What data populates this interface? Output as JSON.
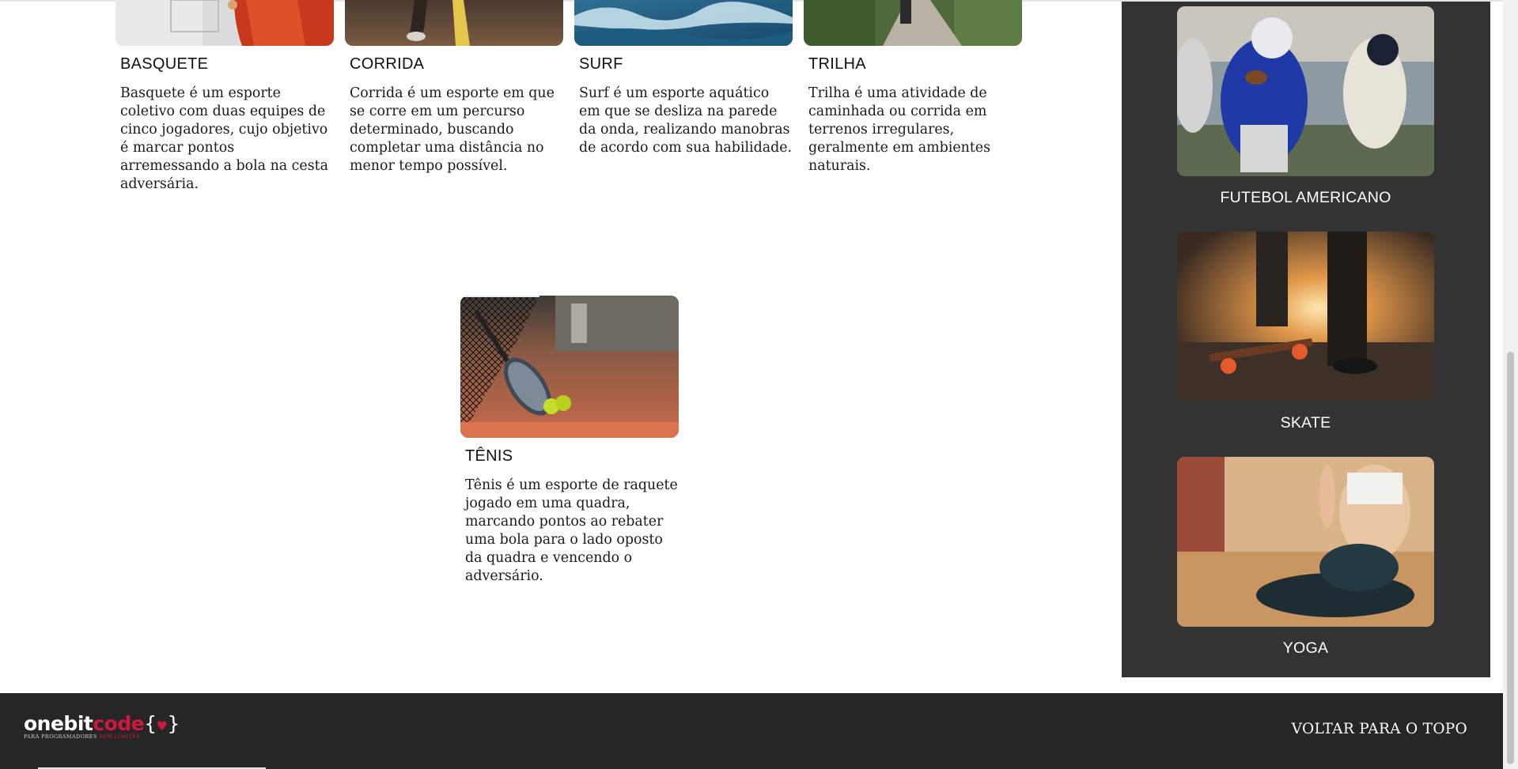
{
  "cards_top": [
    {
      "title": "BASQUETE",
      "text": "Basquete é um esporte coletivo com duas equipes de cinco jogadores, cujo objetivo é marcar pontos arremessando a bola na cesta adversária.",
      "image_alt": "basketball-photo"
    },
    {
      "title": "CORRIDA",
      "text": "Corrida é um esporte em que se corre em um percurso determinado, buscando completar uma distância no menor tempo possível.",
      "image_alt": "running-photo"
    },
    {
      "title": "SURF",
      "text": "Surf é um esporte aquático em que se desliza na parede da onda, realizando manobras de acordo com sua habilidade.",
      "image_alt": "surf-photo"
    },
    {
      "title": "TRILHA",
      "text": "Trilha é uma atividade de caminhada ou corrida em terrenos irregulares, geralmente em ambientes naturais.",
      "image_alt": "trail-photo"
    }
  ],
  "card_tenis": {
    "title": "TÊNIS",
    "text": "Tênis é um esporte de raquete jogado em uma quadra, marcando pontos ao rebater uma bola para o lado oposto da quadra e vencendo o adversário.",
    "image_alt": "tennis-photo"
  },
  "sidebar": {
    "items": [
      {
        "label": "FUTEBOL AMERICANO",
        "image_alt": "american-football-photo"
      },
      {
        "label": "SKATE",
        "image_alt": "skate-photo"
      },
      {
        "label": "YOGA",
        "image_alt": "yoga-photo"
      }
    ]
  },
  "footer": {
    "logo_part1": "onebit",
    "logo_part2": "code",
    "logo_tagline": "PARA PROGRAMADORES",
    "logo_tagline_accent": "SEM LIMITES",
    "back_to_top": "VOLTAR PARA O TOPO"
  },
  "colors": {
    "sidebar_bg": "#333333",
    "footer_bg": "#262626",
    "brand_red": "#d0173f"
  }
}
